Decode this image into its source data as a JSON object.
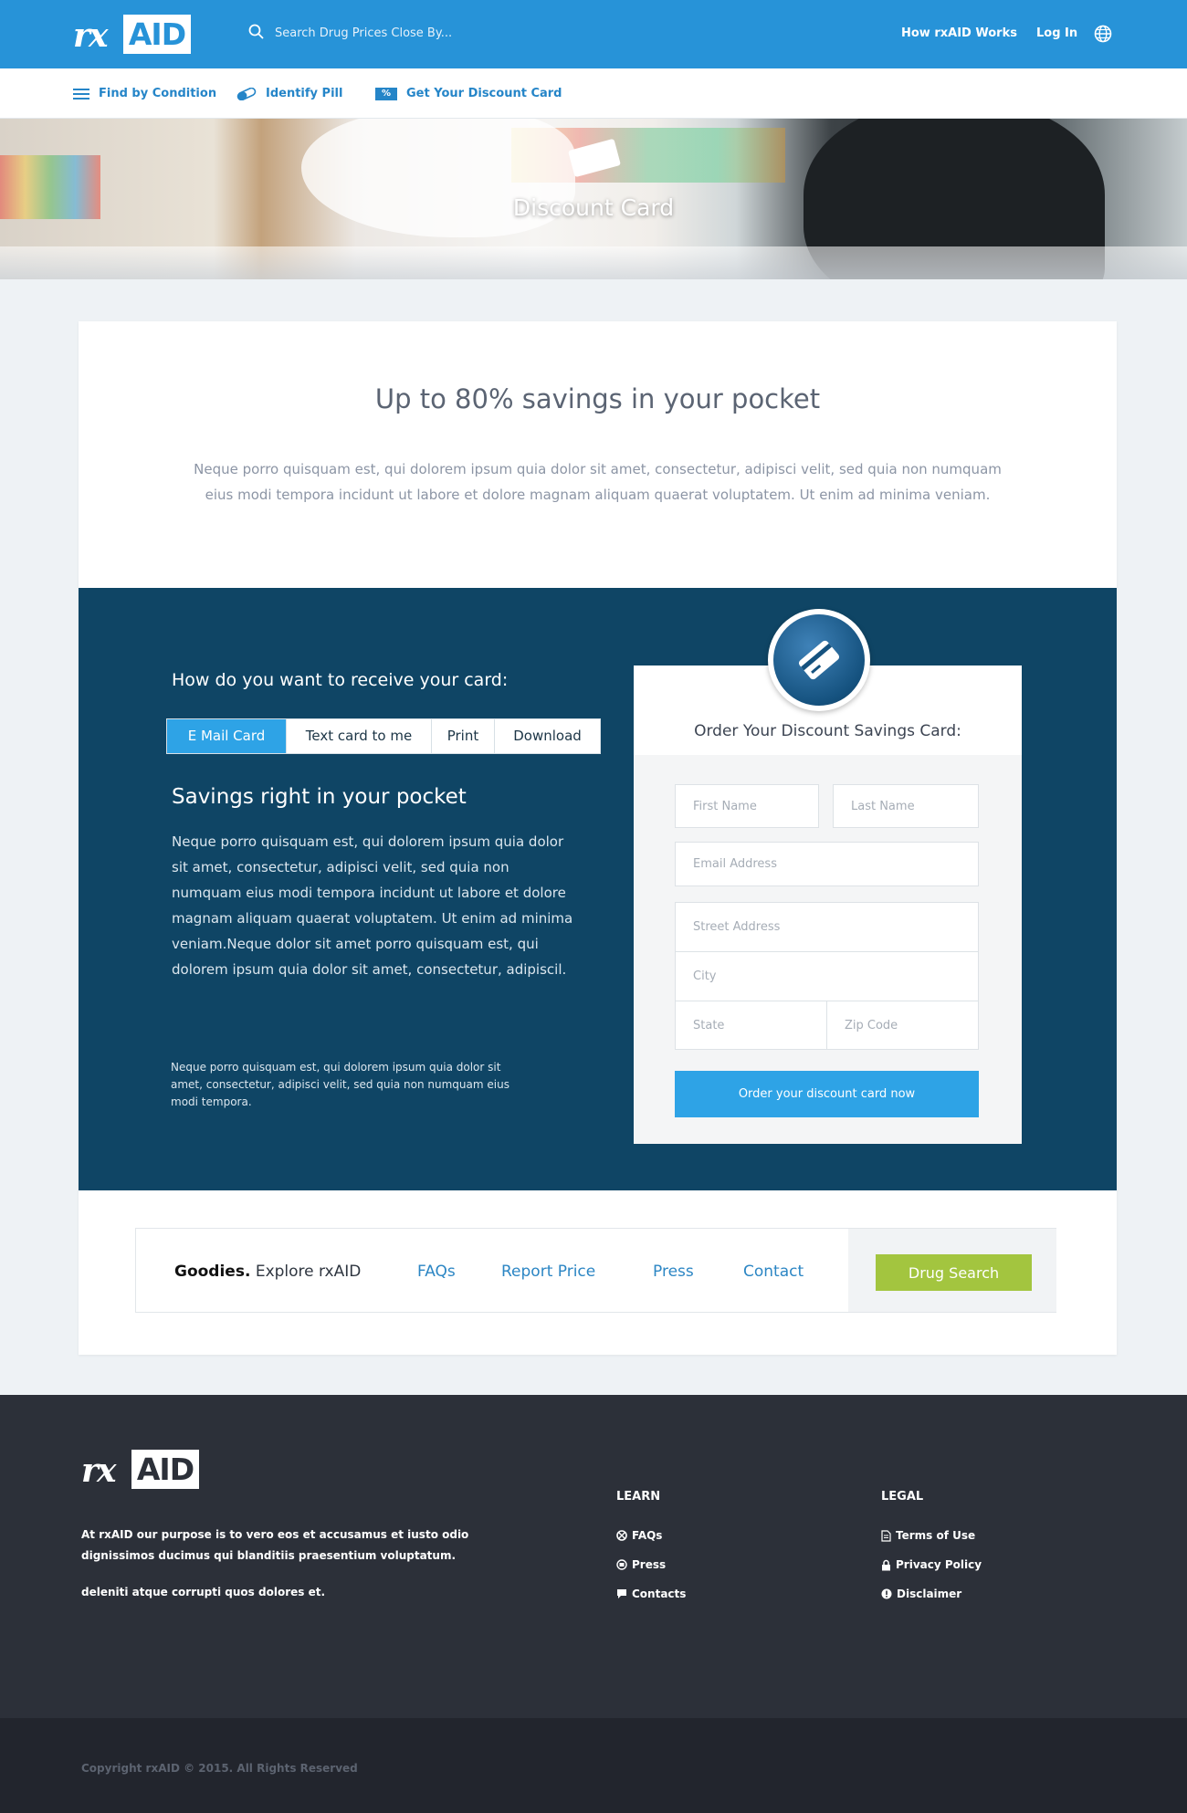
{
  "header": {
    "logo_rx": "rx",
    "logo_aid": "AID",
    "search_placeholder": "Search Drug Prices Close By...",
    "how_it_works": "How rxAID Works",
    "login": "Log In",
    "globe_icon": "globe-icon",
    "search_icon": "search-icon"
  },
  "subnav": {
    "items": [
      {
        "label": "Find by Condition",
        "icon": "menu-icon"
      },
      {
        "label": "Identify Pill",
        "icon": "pill-icon"
      },
      {
        "label": "Get Your Discount Card",
        "icon": "percent-badge-icon",
        "badge": "%"
      }
    ]
  },
  "hero": {
    "title": "Discount Card"
  },
  "intro": {
    "headline": "Up to 80% savings in your pocket",
    "text": "Neque porro quisquam est, qui dolorem ipsum quia dolor sit amet, consectetur, adipisci velit, sed quia non numquam eius modi tempora incidunt ut labore et dolore magnam aliquam quaerat voluptatem. Ut enim ad minima veniam."
  },
  "receive": {
    "title": "How do you want to receive your card:",
    "tabs": [
      {
        "label": "E Mail Card",
        "active": true
      },
      {
        "label": "Text card to me",
        "active": false
      },
      {
        "label": "Print",
        "active": false
      },
      {
        "label": "Download",
        "active": false
      }
    ],
    "savings_title": "Savings right in your pocket",
    "savings_text": "Neque porro quisquam est, qui dolorem ipsum quia dolor sit amet, consectetur, adipisci velit, sed quia non numquam eius modi tempora incidunt ut labore et dolore magnam aliquam quaerat voluptatem. Ut enim ad minima veniam.Neque dolor sit amet porro quisquam est, qui dolorem ipsum quia dolor sit amet, consectetur, adipiscil.",
    "small_text": "Neque porro quisquam est, qui dolorem ipsum quia dolor sit amet, consectetur, adipisci velit, sed quia non numquam eius modi tempora."
  },
  "form": {
    "title": "Order Your Discount Savings Card:",
    "first_name": "First Name",
    "last_name": "Last Name",
    "email": "Email Address",
    "street": "Street Address",
    "city": "City",
    "state": "State",
    "zip": "Zip Code",
    "submit": "Order your discount card now"
  },
  "goodies": {
    "lead_bold": "Goodies.",
    "lead_rest": " Explore rxAID",
    "links": [
      "FAQs",
      "Report Price",
      "Press",
      "Contact"
    ],
    "drug_search": "Drug Search"
  },
  "footer": {
    "logo_rx": "rx",
    "logo_aid": "AID",
    "about": "At rxAID our purpose is to vero eos et accusamus et iusto odio dignissimos ducimus qui blanditiis praesentium voluptatum.",
    "about2": "deleniti atque corrupti quos dolores et.",
    "learn_title": "LEARN",
    "learn": [
      {
        "label": "FAQs",
        "icon": "faq-icon"
      },
      {
        "label": "Press",
        "icon": "press-icon"
      },
      {
        "label": "Contacts",
        "icon": "chat-icon"
      }
    ],
    "legal_title": "LEGAL",
    "legal": [
      {
        "label": "Terms of Use",
        "icon": "document-icon"
      },
      {
        "label": "Privacy Policy",
        "icon": "lock-icon"
      },
      {
        "label": "Disclaimer",
        "icon": "info-icon"
      }
    ],
    "copyright": "Copyright rxAID © 2015. All Rights Reserved"
  },
  "colors": {
    "header_blue": "#2793d8",
    "link_blue": "#2585c8",
    "band_navy": "#0f4565",
    "accent_blue": "#2ea3e6",
    "drug_green": "#a3c53f",
    "footer_dark": "#2c3039"
  }
}
